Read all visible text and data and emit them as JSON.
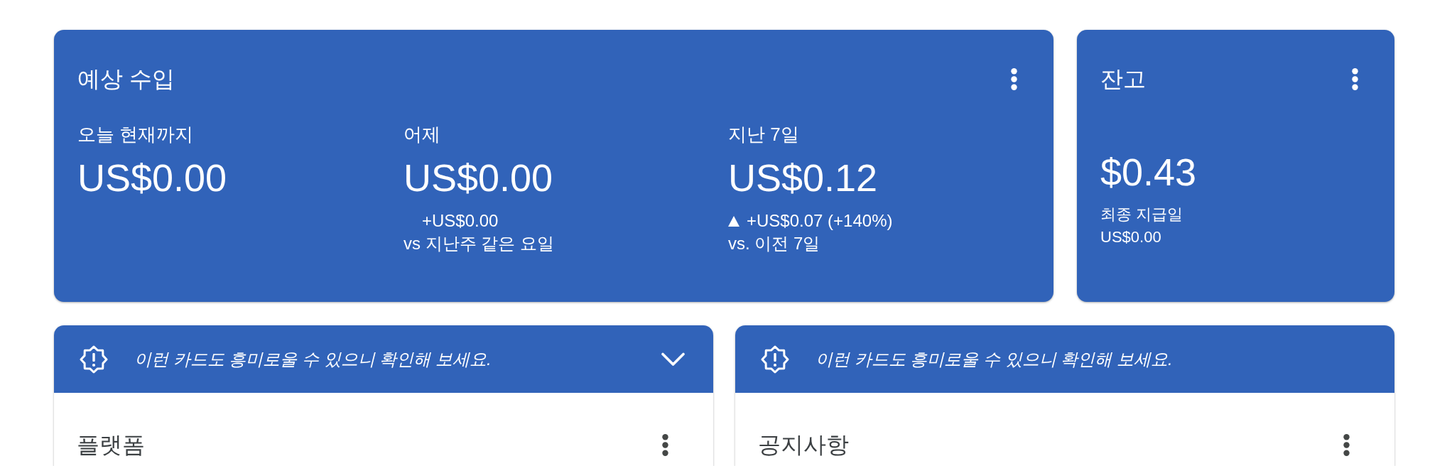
{
  "earnings_card": {
    "title": "예상 수입",
    "periods": [
      {
        "label": "오늘 현재까지",
        "amount": "US$0.00"
      },
      {
        "label": "어제",
        "amount": "US$0.00",
        "change": {
          "kind": "flat",
          "text": "+US$0.00"
        },
        "comparison": "vs 지난주 같은 요일"
      },
      {
        "label": "지난 7일",
        "amount": "US$0.12",
        "change": {
          "kind": "up",
          "text": "+US$0.07 (+140%)"
        },
        "comparison": "vs. 이전 7일"
      }
    ]
  },
  "balance_card": {
    "title": "잔고",
    "amount": "$0.43",
    "last_payment_label": "최종 지급일",
    "last_payment_amount": "US$0.00"
  },
  "info_cards": [
    {
      "banner": "이런 카드도 흥미로울 수 있으니 확인해 보세요.",
      "expand_button": true,
      "title": "플랫폼"
    },
    {
      "banner": "이런 카드도 흥미로울 수 있으니 확인해 보세요.",
      "expand_button": false,
      "title": "공지사항"
    }
  ]
}
